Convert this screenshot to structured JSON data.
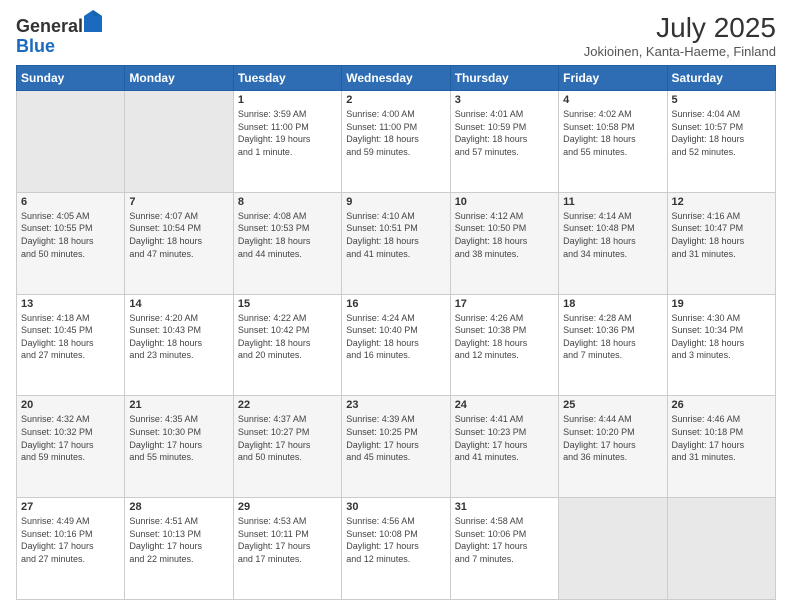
{
  "header": {
    "logo_general": "General",
    "logo_blue": "Blue",
    "title": "July 2025",
    "subtitle": "Jokioinen, Kanta-Haeme, Finland"
  },
  "weekdays": [
    "Sunday",
    "Monday",
    "Tuesday",
    "Wednesday",
    "Thursday",
    "Friday",
    "Saturday"
  ],
  "weeks": [
    [
      {
        "day": "",
        "info": ""
      },
      {
        "day": "",
        "info": ""
      },
      {
        "day": "1",
        "info": "Sunrise: 3:59 AM\nSunset: 11:00 PM\nDaylight: 19 hours\nand 1 minute."
      },
      {
        "day": "2",
        "info": "Sunrise: 4:00 AM\nSunset: 11:00 PM\nDaylight: 18 hours\nand 59 minutes."
      },
      {
        "day": "3",
        "info": "Sunrise: 4:01 AM\nSunset: 10:59 PM\nDaylight: 18 hours\nand 57 minutes."
      },
      {
        "day": "4",
        "info": "Sunrise: 4:02 AM\nSunset: 10:58 PM\nDaylight: 18 hours\nand 55 minutes."
      },
      {
        "day": "5",
        "info": "Sunrise: 4:04 AM\nSunset: 10:57 PM\nDaylight: 18 hours\nand 52 minutes."
      }
    ],
    [
      {
        "day": "6",
        "info": "Sunrise: 4:05 AM\nSunset: 10:55 PM\nDaylight: 18 hours\nand 50 minutes."
      },
      {
        "day": "7",
        "info": "Sunrise: 4:07 AM\nSunset: 10:54 PM\nDaylight: 18 hours\nand 47 minutes."
      },
      {
        "day": "8",
        "info": "Sunrise: 4:08 AM\nSunset: 10:53 PM\nDaylight: 18 hours\nand 44 minutes."
      },
      {
        "day": "9",
        "info": "Sunrise: 4:10 AM\nSunset: 10:51 PM\nDaylight: 18 hours\nand 41 minutes."
      },
      {
        "day": "10",
        "info": "Sunrise: 4:12 AM\nSunset: 10:50 PM\nDaylight: 18 hours\nand 38 minutes."
      },
      {
        "day": "11",
        "info": "Sunrise: 4:14 AM\nSunset: 10:48 PM\nDaylight: 18 hours\nand 34 minutes."
      },
      {
        "day": "12",
        "info": "Sunrise: 4:16 AM\nSunset: 10:47 PM\nDaylight: 18 hours\nand 31 minutes."
      }
    ],
    [
      {
        "day": "13",
        "info": "Sunrise: 4:18 AM\nSunset: 10:45 PM\nDaylight: 18 hours\nand 27 minutes."
      },
      {
        "day": "14",
        "info": "Sunrise: 4:20 AM\nSunset: 10:43 PM\nDaylight: 18 hours\nand 23 minutes."
      },
      {
        "day": "15",
        "info": "Sunrise: 4:22 AM\nSunset: 10:42 PM\nDaylight: 18 hours\nand 20 minutes."
      },
      {
        "day": "16",
        "info": "Sunrise: 4:24 AM\nSunset: 10:40 PM\nDaylight: 18 hours\nand 16 minutes."
      },
      {
        "day": "17",
        "info": "Sunrise: 4:26 AM\nSunset: 10:38 PM\nDaylight: 18 hours\nand 12 minutes."
      },
      {
        "day": "18",
        "info": "Sunrise: 4:28 AM\nSunset: 10:36 PM\nDaylight: 18 hours\nand 7 minutes."
      },
      {
        "day": "19",
        "info": "Sunrise: 4:30 AM\nSunset: 10:34 PM\nDaylight: 18 hours\nand 3 minutes."
      }
    ],
    [
      {
        "day": "20",
        "info": "Sunrise: 4:32 AM\nSunset: 10:32 PM\nDaylight: 17 hours\nand 59 minutes."
      },
      {
        "day": "21",
        "info": "Sunrise: 4:35 AM\nSunset: 10:30 PM\nDaylight: 17 hours\nand 55 minutes."
      },
      {
        "day": "22",
        "info": "Sunrise: 4:37 AM\nSunset: 10:27 PM\nDaylight: 17 hours\nand 50 minutes."
      },
      {
        "day": "23",
        "info": "Sunrise: 4:39 AM\nSunset: 10:25 PM\nDaylight: 17 hours\nand 45 minutes."
      },
      {
        "day": "24",
        "info": "Sunrise: 4:41 AM\nSunset: 10:23 PM\nDaylight: 17 hours\nand 41 minutes."
      },
      {
        "day": "25",
        "info": "Sunrise: 4:44 AM\nSunset: 10:20 PM\nDaylight: 17 hours\nand 36 minutes."
      },
      {
        "day": "26",
        "info": "Sunrise: 4:46 AM\nSunset: 10:18 PM\nDaylight: 17 hours\nand 31 minutes."
      }
    ],
    [
      {
        "day": "27",
        "info": "Sunrise: 4:49 AM\nSunset: 10:16 PM\nDaylight: 17 hours\nand 27 minutes."
      },
      {
        "day": "28",
        "info": "Sunrise: 4:51 AM\nSunset: 10:13 PM\nDaylight: 17 hours\nand 22 minutes."
      },
      {
        "day": "29",
        "info": "Sunrise: 4:53 AM\nSunset: 10:11 PM\nDaylight: 17 hours\nand 17 minutes."
      },
      {
        "day": "30",
        "info": "Sunrise: 4:56 AM\nSunset: 10:08 PM\nDaylight: 17 hours\nand 12 minutes."
      },
      {
        "day": "31",
        "info": "Sunrise: 4:58 AM\nSunset: 10:06 PM\nDaylight: 17 hours\nand 7 minutes."
      },
      {
        "day": "",
        "info": ""
      },
      {
        "day": "",
        "info": ""
      }
    ]
  ]
}
